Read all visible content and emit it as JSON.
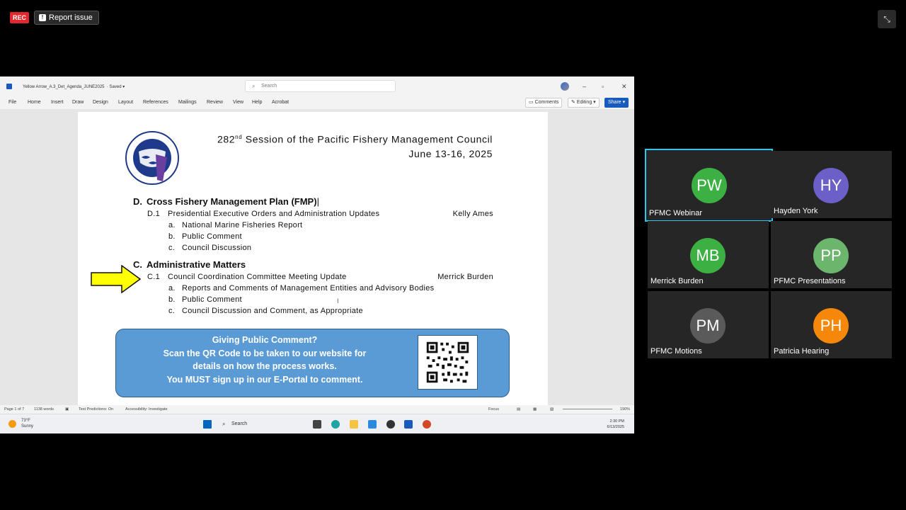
{
  "meeting": {
    "rec_label": "REC",
    "report_issue_label": "Report issue"
  },
  "word": {
    "doc_name": "Yellow Arrow_A.3_Det_Agenda_JUNE2025",
    "save_status": "Saved",
    "search_placeholder": "Search",
    "menu": [
      "File",
      "Home",
      "Insert",
      "Draw",
      "Design",
      "Layout",
      "References",
      "Mailings",
      "Review",
      "View",
      "Help",
      "Acrobat"
    ],
    "comments_label": "Comments",
    "editing_label": "Editing",
    "share_label": "Share",
    "status": {
      "page": "Page 1 of 7",
      "words": "1138 words",
      "text_predictions": "Text Predictions: On",
      "accessibility": "Accessibility: Investigate",
      "focus": "Focus",
      "zoom": "190%"
    }
  },
  "document": {
    "session_title": "Session of the Pacific Fishery Management Council",
    "session_number": "282",
    "session_suffix": "nd",
    "dates": "June 13-16, 2025",
    "section_d": {
      "letter": "D.",
      "title": "Cross Fishery Management Plan (FMP)",
      "item_num": "D.1",
      "item_title": "Presidential Executive Orders and Administration Updates",
      "presenter": "Kelly Ames",
      "subitems": [
        {
          "letter": "a.",
          "text": "National Marine Fisheries Report"
        },
        {
          "letter": "b.",
          "text": "Public Comment"
        },
        {
          "letter": "c.",
          "text": "Council Discussion"
        }
      ]
    },
    "section_c": {
      "letter": "C.",
      "title": "Administrative Matters",
      "item_num": "C.1",
      "item_title": "Council Coordination Committee Meeting Update",
      "presenter": "Merrick Burden",
      "subitems": [
        {
          "letter": "a.",
          "text": "Reports and Comments of Management Entities and Advisory Bodies"
        },
        {
          "letter": "b.",
          "text": "Public Comment"
        },
        {
          "letter": "c.",
          "text": "Council Discussion and Comment, as Appropriate"
        }
      ]
    },
    "banner_lines": [
      "Giving Public Comment?",
      "Scan the QR Code to be taken to our website for",
      "details on how the process works.",
      "You MUST sign up in our E-Portal to comment."
    ]
  },
  "taskbar": {
    "temp": "73°F",
    "weather": "Sunny",
    "search_label": "Search",
    "time": "2:30 PM",
    "date": "6/13/2025"
  },
  "participants": [
    {
      "initials": "PW",
      "name": "PFMC Webinar",
      "color": "#3cb043",
      "active": true
    },
    {
      "initials": "HY",
      "name": "Hayden York",
      "color": "#6c5fc7",
      "active": false
    },
    {
      "initials": "MB",
      "name": "Merrick Burden",
      "color": "#3cb043",
      "active": false
    },
    {
      "initials": "PP",
      "name": "PFMC Presentations",
      "color": "#6cb56c",
      "active": false
    },
    {
      "initials": "PM",
      "name": "PFMC Motions",
      "color": "#5a5a5a",
      "active": false
    },
    {
      "initials": "PH",
      "name": "Patricia Hearing",
      "color": "#f5870a",
      "active": false
    }
  ]
}
